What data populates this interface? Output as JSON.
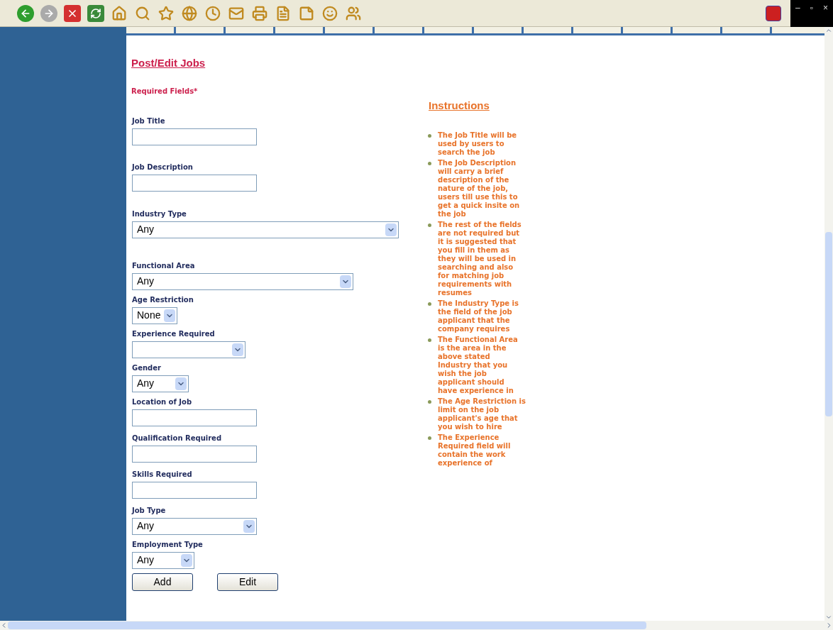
{
  "window_controls": [
    "–",
    "▫",
    "×"
  ],
  "page": {
    "title": "Post/Edit Jobs",
    "required_note": "Required Fields*"
  },
  "fields": [
    {
      "kind": "text",
      "label": "Job Title"
    },
    {
      "kind": "text",
      "label": "Job Description"
    },
    {
      "kind": "select",
      "label": "Industry Type",
      "value": "Any"
    },
    {
      "kind": "select",
      "label": "Functional Area",
      "value": "Any"
    },
    {
      "kind": "select",
      "label": "Age Restriction",
      "value": "None"
    },
    {
      "kind": "select",
      "label": "Experience Required"
    },
    {
      "kind": "select",
      "label": "Gender",
      "value": "Any"
    },
    {
      "kind": "text",
      "label": "Location of Job"
    },
    {
      "kind": "text",
      "label": "Qualification Required"
    },
    {
      "kind": "text",
      "label": "Skills Required"
    },
    {
      "kind": "select",
      "label": "Job Type",
      "value": "Any"
    },
    {
      "kind": "select",
      "label": "Employment Type",
      "value": "Any"
    }
  ],
  "buttons": [
    "Add",
    "Edit"
  ],
  "instructions": {
    "heading": "Instructions",
    "items": [
      "The Job Title will be used by users to search the job",
      "The Job Description will carry a brief description of the nature of the job, users till use this to get a quick insite on the job",
      "The rest of the fields are not required but it is suggested that you fill in them as they will be used in searching and also for matching job requirements with resumes",
      "The Industry Type is the field of the job applicant that the company requires",
      "The Functional Area is the area in the above stated Industry that you wish the job applicant should have experience in",
      "The Age Restriction is limit on the job applicant's age that you wish to hire",
      "The Experience Required field will contain the work experience of"
    ]
  }
}
